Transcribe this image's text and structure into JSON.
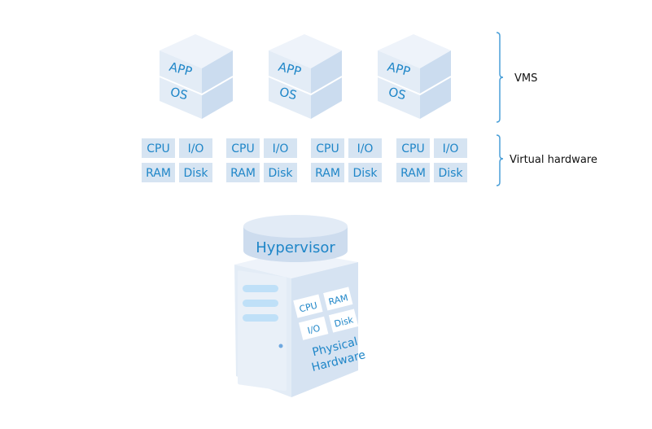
{
  "vms": [
    {
      "app": "APP",
      "os": "OS"
    },
    {
      "app": "APP",
      "os": "OS"
    },
    {
      "app": "APP",
      "os": "OS"
    }
  ],
  "virtual_hardware": [
    {
      "cpu": "CPU",
      "io": "I/O",
      "ram": "RAM",
      "disk": "Disk"
    },
    {
      "cpu": "CPU",
      "io": "I/O",
      "ram": "RAM",
      "disk": "Disk"
    },
    {
      "cpu": "CPU",
      "io": "I/O",
      "ram": "RAM",
      "disk": "Disk"
    },
    {
      "cpu": "CPU",
      "io": "I/O",
      "ram": "RAM",
      "disk": "Disk"
    }
  ],
  "labels": {
    "vms": "VMS",
    "virtual_hardware": "Virtual hardware"
  },
  "hypervisor": {
    "label": "Hypervisor"
  },
  "physical": {
    "cpu": "CPU",
    "ram": "RAM",
    "io": "I/O",
    "disk": "Disk",
    "line1": "Physical",
    "line2": "Hardware"
  },
  "colors": {
    "accent": "#1f86c8",
    "bracket": "#4a9fd8",
    "cell": "#d6e4f2",
    "face_light": "#e8eff8",
    "face_mid": "#dbe6f3",
    "face_dark": "#c9daee"
  }
}
